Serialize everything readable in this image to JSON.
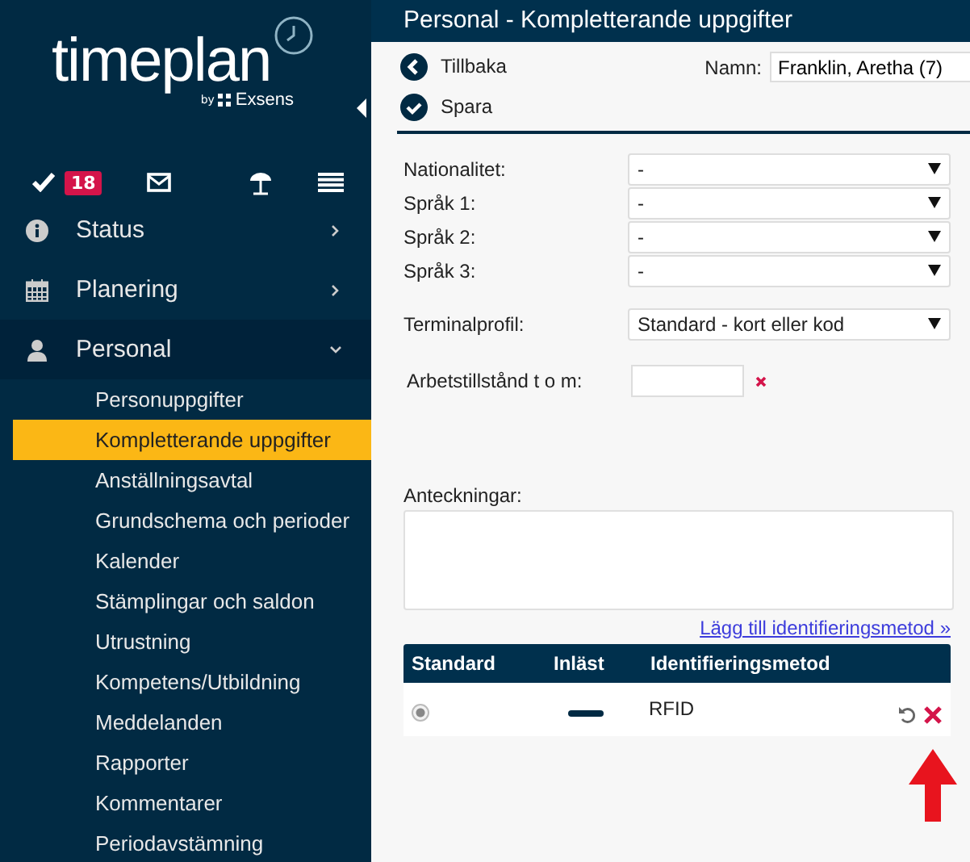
{
  "logo": {
    "name": "timeplan",
    "byline": "by",
    "brand": "Exsens"
  },
  "toolbar": {
    "badge": "18"
  },
  "nav": [
    {
      "label": "Status",
      "kind": "info",
      "expanded": false
    },
    {
      "label": "Planering",
      "kind": "calendar",
      "expanded": false
    },
    {
      "label": "Personal",
      "kind": "person",
      "expanded": true,
      "children": [
        {
          "label": "Personuppgifter",
          "selected": false
        },
        {
          "label": "Kompletterande uppgifter",
          "selected": true
        },
        {
          "label": "Anställningsavtal",
          "selected": false
        },
        {
          "label": "Grundschema och perioder",
          "selected": false
        },
        {
          "label": "Kalender",
          "selected": false
        },
        {
          "label": "Stämplingar och saldon",
          "selected": false
        },
        {
          "label": "Utrustning",
          "selected": false
        },
        {
          "label": "Kompetens/Utbildning",
          "selected": false
        },
        {
          "label": "Meddelanden",
          "selected": false
        },
        {
          "label": "Rapporter",
          "selected": false
        },
        {
          "label": "Kommentarer",
          "selected": false
        },
        {
          "label": "Periodavstämning",
          "selected": false
        }
      ]
    }
  ],
  "header": {
    "title": "Personal - Kompletterande uppgifter"
  },
  "actions": [
    {
      "label": "Tillbaka",
      "kind": "back"
    },
    {
      "label": "Spara",
      "kind": "save"
    }
  ],
  "name_field": {
    "label": "Namn:",
    "value": "Franklin, Aretha (7)"
  },
  "selects": [
    {
      "label": "Nationalitet:",
      "value": "-"
    },
    {
      "label": "Språk 1:",
      "value": "-"
    },
    {
      "label": "Språk 2:",
      "value": "-"
    },
    {
      "label": "Språk 3:",
      "value": "-"
    }
  ],
  "terminal": {
    "label": "Terminalprofil:",
    "value": "Standard - kort eller kod"
  },
  "permit": {
    "label": "Arbetstillstånd t o m:"
  },
  "notes": {
    "label": "Anteckningar:"
  },
  "add_link": "Lägg till identifieringsmetod »",
  "table": {
    "columns": [
      "Standard",
      "Inläst",
      "Identifieringsmetod"
    ],
    "rows": [
      {
        "selected": true,
        "method": "RFID"
      }
    ]
  }
}
